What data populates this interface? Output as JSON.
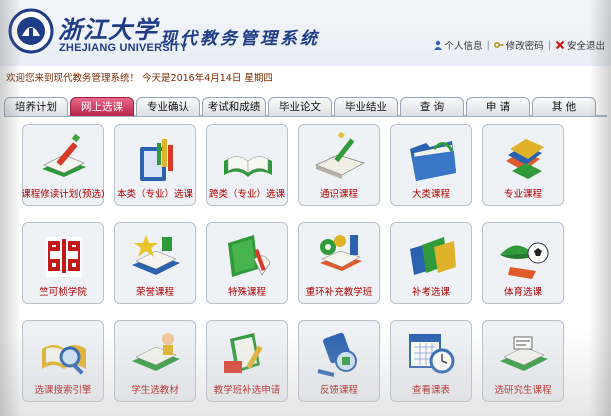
{
  "header": {
    "university_cn": "浙江大学",
    "university_en": "ZHEJIANG UNIVERSITY",
    "system_name": "现代教务管理系统",
    "links": [
      {
        "label": "个人信息",
        "icon": "person-icon"
      },
      {
        "label": "修改密码",
        "icon": "key-icon"
      },
      {
        "label": "安全退出",
        "icon": "close-icon"
      }
    ],
    "separator": "|"
  },
  "welcome": "欢迎您来到现代教务管理系统！  今天是2016年4月14日 星期四",
  "tabs": [
    {
      "label": "培养计划",
      "active": false
    },
    {
      "label": "网上选课",
      "active": true
    },
    {
      "label": "专业确认",
      "active": false
    },
    {
      "label": "考试和成绩",
      "active": false
    },
    {
      "label": "毕业论文",
      "active": false
    },
    {
      "label": "毕业结业",
      "active": false
    },
    {
      "label": "查  询",
      "active": false
    },
    {
      "label": "申  请",
      "active": false
    },
    {
      "label": "其  他",
      "active": false
    }
  ],
  "modules": [
    {
      "label": "课程修读计划(预选)",
      "icon": "book-pencil-icon"
    },
    {
      "label": "本类（专业）选课",
      "icon": "book-pens-icon"
    },
    {
      "label": "跨类（专业）选课",
      "icon": "open-book-icon"
    },
    {
      "label": "通识课程",
      "icon": "notebook-pen-icon"
    },
    {
      "label": "大类课程",
      "icon": "folder-icon"
    },
    {
      "label": "专业课程",
      "icon": "books-stack-icon"
    },
    {
      "label": "竺可桢学院",
      "icon": "seal-icon"
    },
    {
      "label": "荣誉课程",
      "icon": "star-book-icon"
    },
    {
      "label": "特殊课程",
      "icon": "green-book-icon"
    },
    {
      "label": "重环补充教学班",
      "icon": "gears-book-icon"
    },
    {
      "label": "补考选课",
      "icon": "folders-icon"
    },
    {
      "label": "体育选课",
      "icon": "cap-ball-icon"
    },
    {
      "label": "选课搜索引擎",
      "icon": "magnifier-book-icon"
    },
    {
      "label": "学生选教材",
      "icon": "reader-icon"
    },
    {
      "label": "教学班补选申请",
      "icon": "book-apply-icon"
    },
    {
      "label": "反馈课程",
      "icon": "feedback-icon"
    },
    {
      "label": "查看课表",
      "icon": "calendar-clock-icon"
    },
    {
      "label": "选研究生课程",
      "icon": "graduate-book-icon"
    }
  ],
  "colors": {
    "brand_blue": "#1f3c86",
    "active_tab": "#c0325a",
    "module_label": "#b00000",
    "welcome_text": "#7a2a00"
  }
}
